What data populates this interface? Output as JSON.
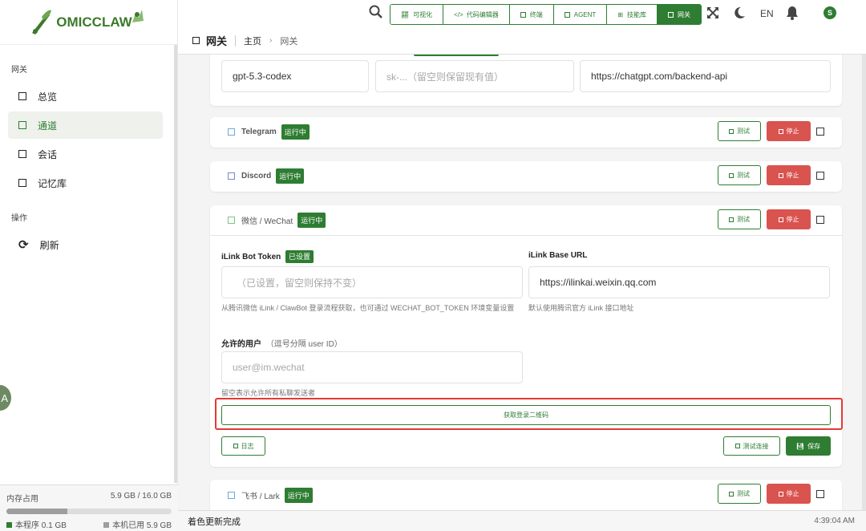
{
  "app": {
    "logo_text": "OMICCLAW"
  },
  "sidebar": {
    "section_gateway": "网关",
    "items": [
      {
        "label": "总览"
      },
      {
        "label": "通道"
      },
      {
        "label": "会话"
      },
      {
        "label": "记忆库"
      }
    ],
    "section_ops": "操作",
    "refresh_label": "刷新",
    "memory": {
      "title": "内存占用",
      "value": "5.9 GB / 16.0 GB",
      "used_fraction": 0.37,
      "app_label": "本程序 0.1 GB",
      "system_label": "本机已用 5.9 GB",
      "app_color": "#2e7d32",
      "system_color": "#9e9e9e"
    },
    "float_avatar": "A"
  },
  "topbar": {
    "tabs": [
      {
        "label": "可视化",
        "icon": "chart-icon"
      },
      {
        "label": "代码编辑器",
        "icon": "code-icon"
      },
      {
        "label": "终端",
        "icon": "terminal-icon"
      },
      {
        "label": "AGENT",
        "icon": "agent-icon"
      },
      {
        "label": "技能库",
        "icon": "grid-icon"
      },
      {
        "label": "网关",
        "icon": "gateway-icon",
        "active": true
      }
    ],
    "language": "EN",
    "user_initial": "S"
  },
  "breadcrumb": {
    "title": "网关",
    "home": "主页",
    "current": "网关"
  },
  "openai_card": {
    "model": "gpt-5.3-codex",
    "key_placeholder": "sk-...（留空则保留现有值）",
    "base_url": "https://chatgpt.com/backend-api"
  },
  "channels": {
    "telegram": {
      "name": "Telegram",
      "status": "运行中",
      "test": "测试",
      "stop": "停止"
    },
    "discord": {
      "name": "Discord",
      "status": "运行中",
      "test": "测试",
      "stop": "停止"
    },
    "wechat": {
      "name": "微信 / WeChat",
      "status": "运行中",
      "test": "测试",
      "stop": "停止",
      "token_label": "iLink Bot Token",
      "token_badge": "已设置",
      "token_placeholder": "（已设置，留空则保持不变）",
      "token_help": "从腾讯微信 iLink / ClawBot 登录流程获取，也可通过 WECHAT_BOT_TOKEN 环境变量设置",
      "base_url_label": "iLink Base URL",
      "base_url_value": "https://ilinkai.weixin.qq.com",
      "base_url_help": "默认使用腾讯官方 iLink 接口地址",
      "allowed_label": "允许的用户",
      "allowed_hint": "（逗号分隔 user ID）",
      "allowed_placeholder": "user@im.wechat",
      "allowed_help": "留空表示允许所有私聊发送者",
      "qr_button": "获取登录二维码",
      "log_button": "日志",
      "test_conn_button": "测试连接",
      "save_button": "保存"
    },
    "lark": {
      "name": "飞书 / Lark",
      "status": "运行中",
      "test": "测试",
      "stop": "停止"
    }
  },
  "statusbar": {
    "message": "着色更新完成",
    "time": "4:39:04 AM"
  },
  "colors": {
    "accent": "#2e7d32",
    "danger": "#d9534f",
    "highlight": "#e53935"
  }
}
